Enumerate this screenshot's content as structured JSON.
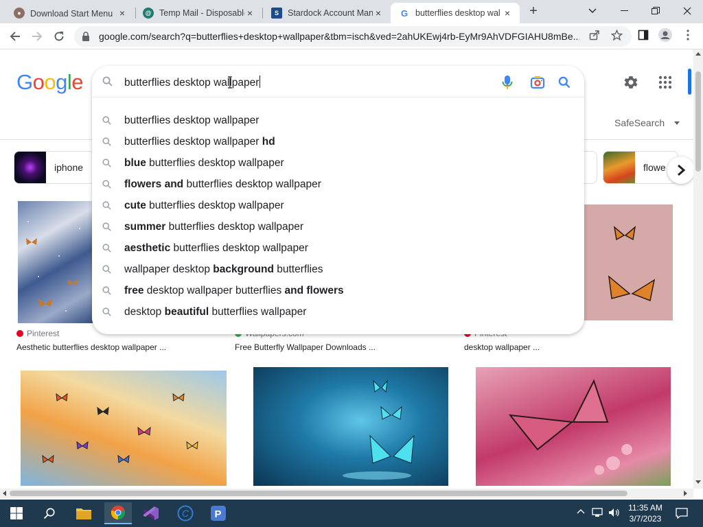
{
  "browser": {
    "tabs": [
      {
        "title": "Download Start Menu ↗",
        "favicon_color": "#8d6e63",
        "close": "×"
      },
      {
        "title": "Temp Mail - Disposable",
        "favicon_color": "#1e7b6f",
        "close": "×"
      },
      {
        "title": "Stardock Account Man",
        "favicon_color": "#1a4b8c",
        "close": "×"
      },
      {
        "title": "butterflies desktop wal",
        "favicon_color": "#4285f4",
        "close": "×"
      }
    ],
    "new_tab": "+",
    "url": "google.com/search?q=butterflies+desktop+wallpaper&tbm=isch&ved=2ahUKEwj4rb-EyMr9AhVDFGIAHU8mBe..."
  },
  "google": {
    "logo_letters": [
      "G",
      "o",
      "o",
      "g",
      "l",
      "e"
    ],
    "logo_colors": [
      "#4285f4",
      "#ea4335",
      "#fbbc05",
      "#4285f4",
      "#34a853",
      "#ea4335"
    ],
    "query": "butterflies desktop wallpaper",
    "suggestions": [
      [
        {
          "t": "butterflies desktop wallpaper",
          "b": false
        }
      ],
      [
        {
          "t": "butterflies desktop wallpaper ",
          "b": false
        },
        {
          "t": "hd",
          "b": true
        }
      ],
      [
        {
          "t": "blue",
          "b": true
        },
        {
          "t": " butterflies desktop wallpaper",
          "b": false
        }
      ],
      [
        {
          "t": "flowers and",
          "b": true
        },
        {
          "t": " butterflies desktop wallpaper",
          "b": false
        }
      ],
      [
        {
          "t": "cute",
          "b": true
        },
        {
          "t": " butterflies desktop wallpaper",
          "b": false
        }
      ],
      [
        {
          "t": "summer",
          "b": true
        },
        {
          "t": " butterflies desktop wallpaper",
          "b": false
        }
      ],
      [
        {
          "t": "aesthetic",
          "b": true
        },
        {
          "t": " butterflies desktop wallpaper",
          "b": false
        }
      ],
      [
        {
          "t": "wallpaper desktop ",
          "b": false
        },
        {
          "t": "background",
          "b": true
        },
        {
          "t": " butterflies",
          "b": false
        }
      ],
      [
        {
          "t": "free",
          "b": true
        },
        {
          "t": " desktop wallpaper butterflies ",
          "b": false
        },
        {
          "t": "and flowers",
          "b": true
        }
      ],
      [
        {
          "t": "desktop ",
          "b": false
        },
        {
          "t": "beautiful",
          "b": true
        },
        {
          "t": " butterflies wallpaper",
          "b": false
        }
      ]
    ],
    "safesearch": "SafeSearch",
    "chips": [
      {
        "label": "iphone"
      },
      {
        "label": "flowe"
      }
    ],
    "results": [
      {
        "source": "Pinterest",
        "caption": "Aesthetic butterflies desktop wallpaper ...",
        "source_color": "#e60023"
      },
      {
        "source": "Wallpapers.com",
        "caption": "Free Butterfly Wallpaper Downloads ...",
        "source_color": "#34a853"
      },
      {
        "source": "Pinterest",
        "caption": "desktop wallpaper ...",
        "source_color": "#e60023"
      }
    ]
  },
  "taskbar": {
    "time": "11:35 AM",
    "date": "3/7/2023"
  }
}
